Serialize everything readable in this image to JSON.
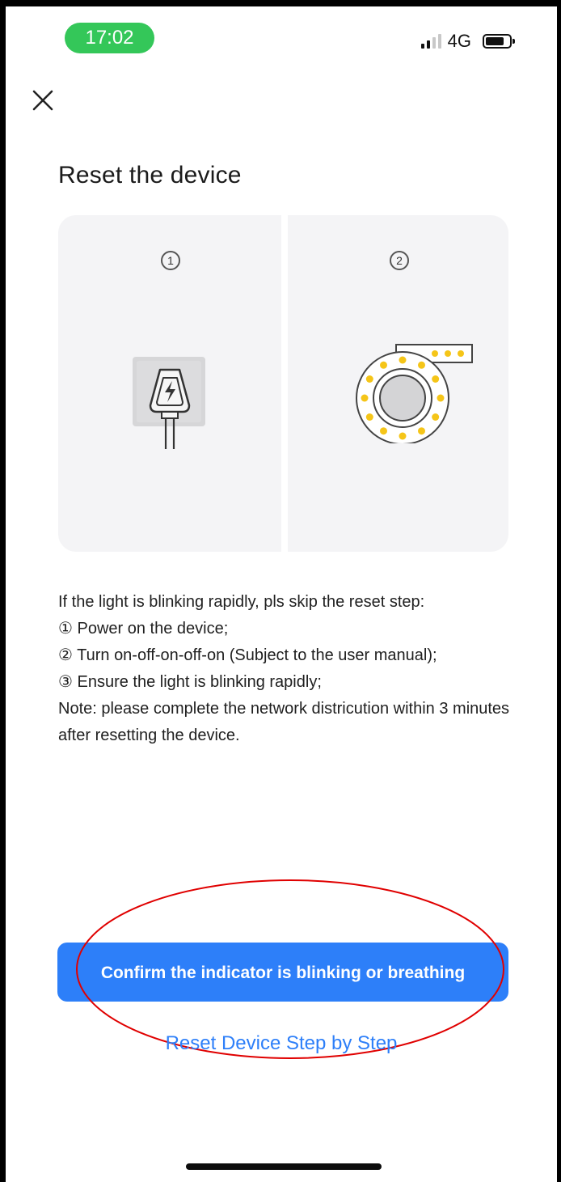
{
  "status_bar": {
    "time": "17:02",
    "network": "4G",
    "signal_bars_active": 2,
    "signal_bars_total": 4,
    "battery_level": 0.8
  },
  "header": {
    "close_icon": "close-icon",
    "title": "Reset the device"
  },
  "illustration": {
    "step1_number": "1",
    "step1_icon": "power-plug-icon",
    "step2_number": "2",
    "step2_icon": "led-indicator-icon",
    "led_color": "#f5c518"
  },
  "instructions": {
    "intro": "If the light is blinking rapidly, pls skip the reset step:",
    "steps": [
      "① Power on the device;",
      "② Turn on-off-on-off-on (Subject to the user manual);",
      "③ Ensure the light is blinking rapidly;"
    ],
    "note": "Note: please complete the network districution within 3 minutes after resetting the device."
  },
  "actions": {
    "confirm_label": "Confirm the indicator is blinking or breathing",
    "step_by_step_label": "Reset Device Step by Step"
  },
  "colors": {
    "accent": "#2d7ff9",
    "time_pill": "#34c759",
    "annotation": "#e00000"
  }
}
